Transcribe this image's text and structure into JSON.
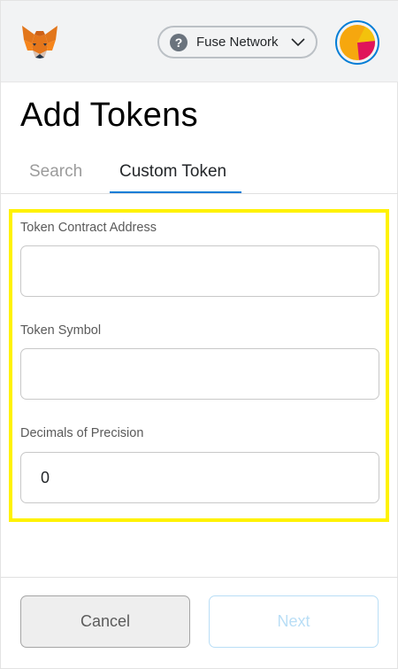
{
  "header": {
    "logo_icon": "metamask-fox-icon",
    "network": {
      "icon": "question-circle-icon",
      "label": "Fuse Network",
      "chevron_icon": "chevron-down-icon"
    },
    "avatar_colors": [
      "#f6a70e",
      "#e0145a",
      "#f3c20c"
    ]
  },
  "page": {
    "title": "Add Tokens"
  },
  "tabs": [
    {
      "label": "Search",
      "active": false
    },
    {
      "label": "Custom Token",
      "active": true
    }
  ],
  "form": {
    "contract_address": {
      "label": "Token Contract Address",
      "value": ""
    },
    "symbol": {
      "label": "Token Symbol",
      "value": ""
    },
    "decimals": {
      "label": "Decimals of Precision",
      "value": "0"
    }
  },
  "footer": {
    "cancel_label": "Cancel",
    "next_label": "Next",
    "next_disabled": true
  },
  "colors": {
    "accent": "#037dd6",
    "highlight": "#fff200",
    "header_bg": "#f2f3f4"
  }
}
